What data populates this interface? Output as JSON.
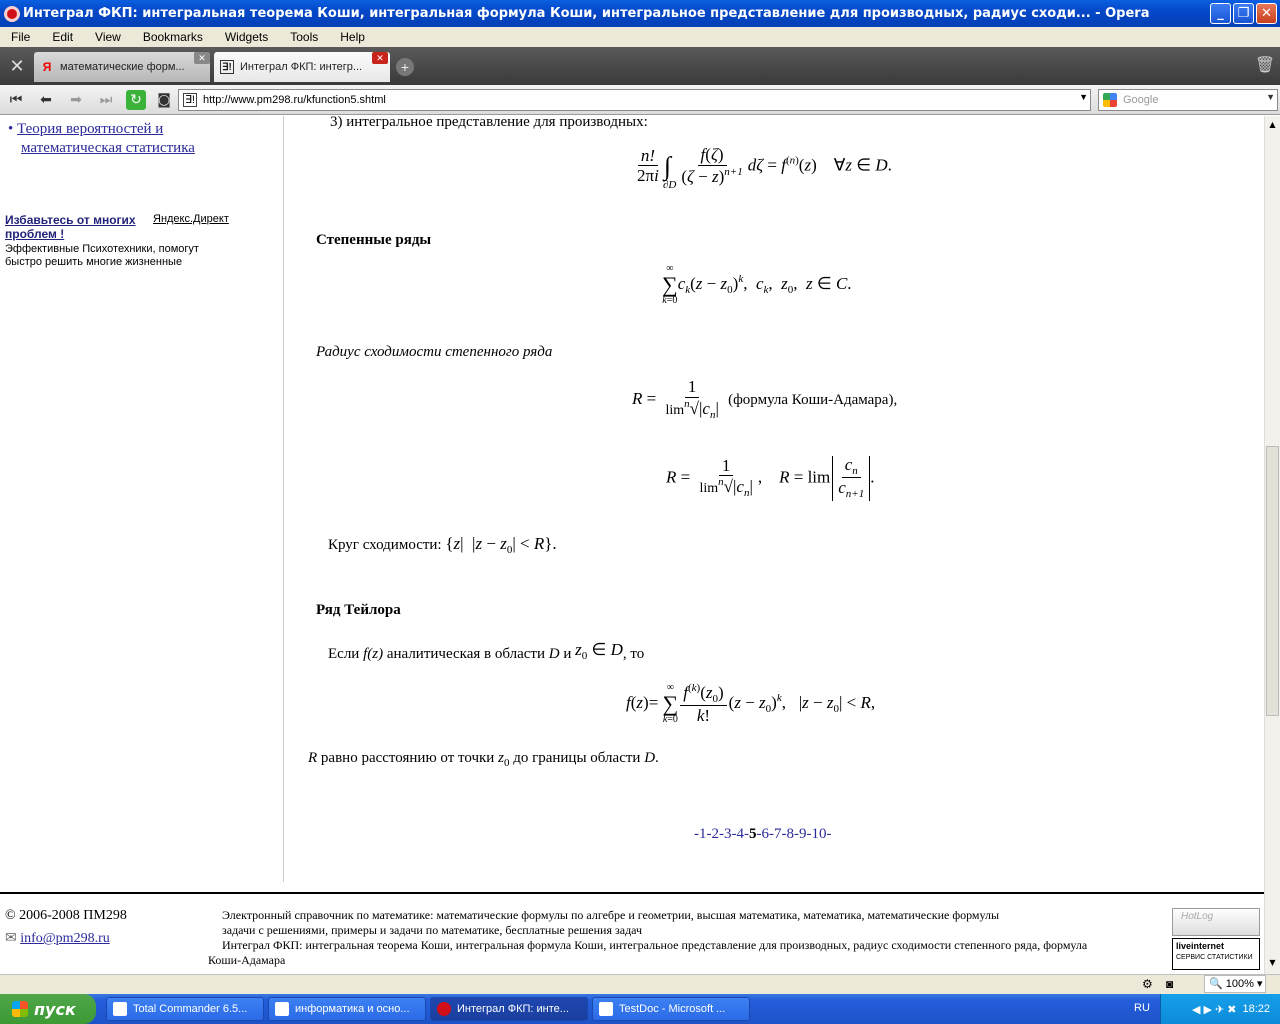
{
  "window": {
    "title": "Интеграл ФКП: интегральная теорема Коши, интегральная формула Коши, интегральное представление для производных, радиус сходи... - Opera"
  },
  "menu": [
    "File",
    "Edit",
    "View",
    "Bookmarks",
    "Widgets",
    "Tools",
    "Help"
  ],
  "tabs": [
    {
      "label": "математические форм...",
      "favicon": "Я"
    },
    {
      "label": "Интеграл ФКП: интегр...",
      "favicon": "∃!"
    }
  ],
  "address": {
    "url": "http://www.pm298.ru/kfunction5.shtml",
    "search_placeholder": "Google"
  },
  "sidebar": {
    "link_text_1": "Теория вероятностей и",
    "link_text_2": "математическая статистика",
    "ad_title_1": "Избавьтесь от многих",
    "ad_title_2": "проблем !",
    "ad_source": "Яндекс.Директ",
    "ad_text_1": "Эффективные Психотехники, помогут",
    "ad_text_2": "быстро решить многие жизненные"
  },
  "article": {
    "item3": "3) интегральное представление для производных:",
    "power_series_heading": "Степенные ряды",
    "radius_heading": "Радиус сходимости степенного ряда",
    "cauchy_hadamard": "(формула Коши-Адамара),",
    "circle_label": "Круг сходимости:",
    "taylor_heading": "Ряд Тейлора",
    "taylor_if": "Если",
    "taylor_fz": "f(z)",
    "taylor_analytic": "аналитическая в области",
    "taylor_D": "D",
    "taylor_and": "и",
    "taylor_then": ", то",
    "R_distance_1": "равно расстоянию от точки",
    "R_distance_2": "до границы области",
    "pager_prefix": "-1-2-3-4-",
    "pager_current": "5",
    "pager_suffix": "-6-7-8-9-10-"
  },
  "footer": {
    "copyright": "© 2006-2008 ПМ298",
    "email": "info@pm298.ru",
    "desc_1": "Электронный справочник по математике: математические формулы по алгебре и геометрии, высшая математика, математика, математические формулы",
    "desc_2": "задачи с решениями, примеры и задачи по математике, бесплатные решения задач",
    "desc_3": "Интеграл ФКП: интегральная теорема Коши, интегральная формула Коши, интегральное представление для производных, радиус сходимости степенного ряда, формула",
    "desc_4": "Коши-Адамара",
    "badge_1": "HotLog",
    "badge_2": "liveinternet",
    "badge_3": "СЕРВИС СТАТИСТИКИ"
  },
  "statusbar": {
    "zoom": "100%"
  },
  "taskbar": {
    "start": "пуск",
    "tasks": [
      "Total Commander 6.5...",
      "информатика и осно...",
      "Интеграл ФКП: инте...",
      "TestDoc - Microsoft ..."
    ],
    "lang": "RU",
    "clock": "18:22"
  }
}
